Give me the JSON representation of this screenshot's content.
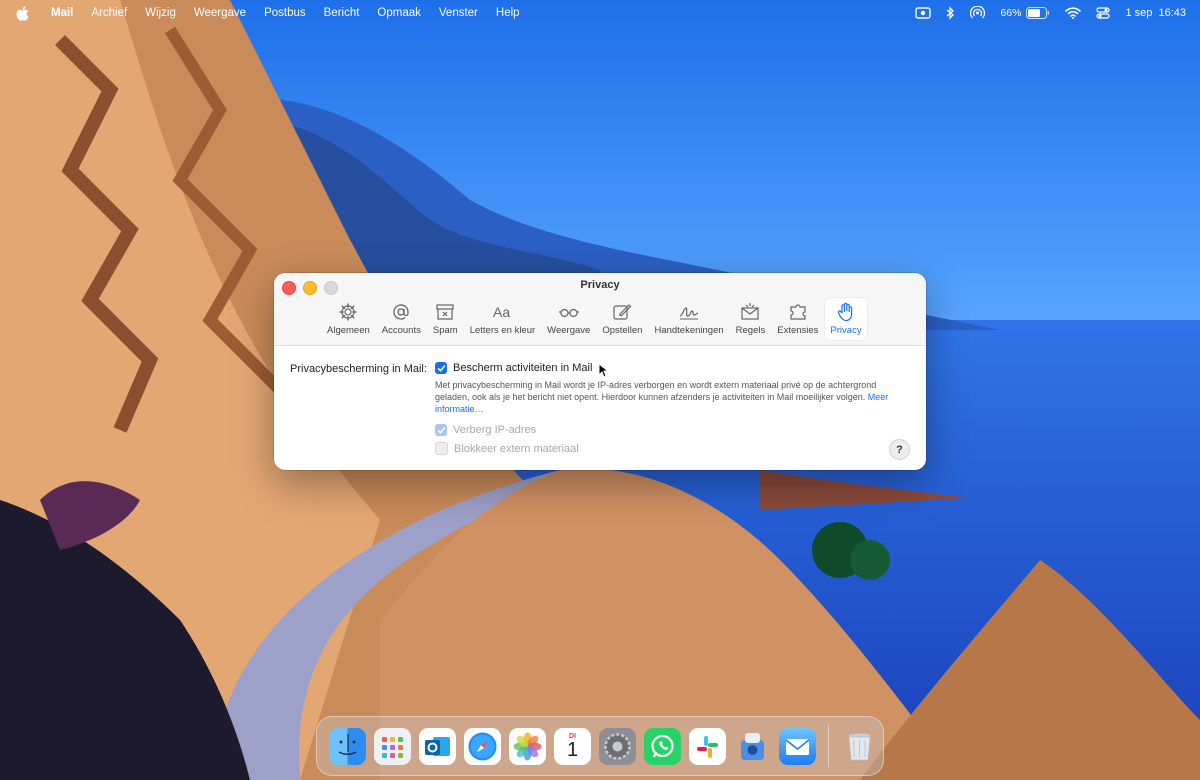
{
  "menubar": {
    "app_name": "Mail",
    "items": [
      "Archief",
      "Wijzig",
      "Weergave",
      "Postbus",
      "Bericht",
      "Opmaak",
      "Venster",
      "Help"
    ],
    "battery": "66%",
    "clock": "1 sep  16:43"
  },
  "window": {
    "title": "Privacy",
    "tabs": [
      {
        "label": "Algemeen",
        "icon": "gear-icon"
      },
      {
        "label": "Accounts",
        "icon": "at-icon"
      },
      {
        "label": "Spam",
        "icon": "junk-tray-icon"
      },
      {
        "label": "Letters en kleur",
        "icon": "font-icon"
      },
      {
        "label": "Weergave",
        "icon": "glasses-icon"
      },
      {
        "label": "Opstellen",
        "icon": "compose-icon"
      },
      {
        "label": "Handtekeningen",
        "icon": "signature-icon"
      },
      {
        "label": "Regels",
        "icon": "rules-envelope-icon"
      },
      {
        "label": "Extensies",
        "icon": "puzzle-icon"
      },
      {
        "label": "Privacy",
        "icon": "hand-icon"
      }
    ],
    "active_tab": "Privacy",
    "privacy": {
      "row_label": "Privacybescherming in Mail:",
      "protect_label": "Bescherm activiteiten in Mail",
      "protect_checked": true,
      "description": "Met privacybescherming in Mail wordt je IP-adres verborgen en wordt extern materiaal privé op de achtergrond geladen, ook als je het bericht niet opent. Hierdoor kunnen afzenders je activiteiten in Mail moeilijker volgen.",
      "more_info": "Meer informatie…",
      "hide_ip_label": "Verberg IP-adres",
      "hide_ip_checked": true,
      "block_label": "Blokkeer extern materiaal",
      "block_checked": false,
      "help": "?"
    }
  },
  "dock": {
    "apps": [
      "finder-icon",
      "launchpad-icon",
      "outlook-icon",
      "safari-icon",
      "photos-icon",
      "calendar-icon",
      "system-settings-icon",
      "whatsapp-icon",
      "slack-icon",
      "preview-icon",
      "mail-icon",
      "trash-icon"
    ],
    "calendar": {
      "month": "DI",
      "day": "1"
    }
  },
  "colors": {
    "accent": "#1a6fe6",
    "close": "#fe5f57",
    "minimize": "#febc2e"
  }
}
